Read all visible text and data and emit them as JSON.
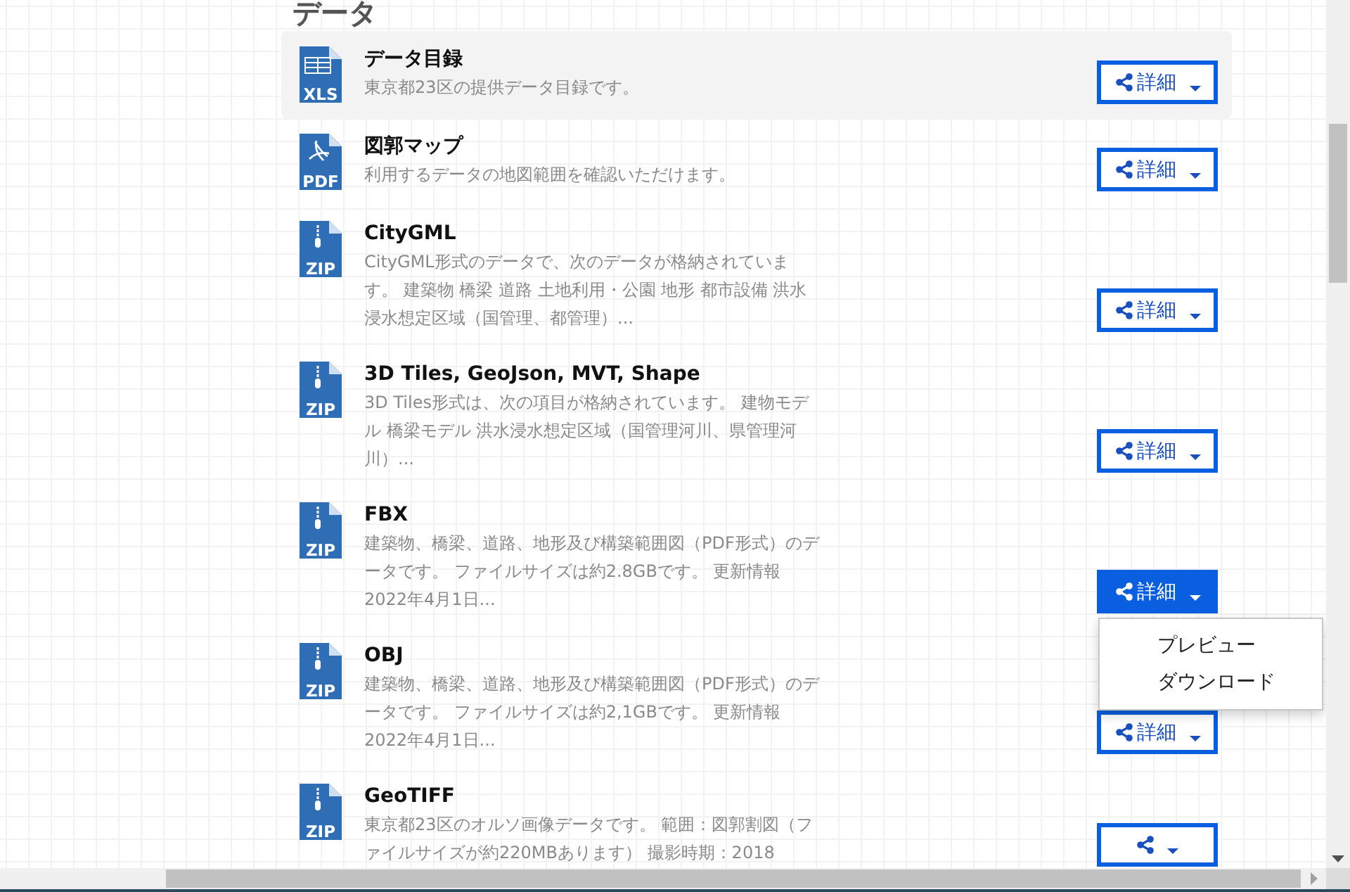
{
  "section": {
    "heading": "データ"
  },
  "items": [
    {
      "title": "データ目録",
      "description": "東京都23区の提供データ目録です。",
      "file_type": "XLS",
      "kind": "spreadsheet",
      "highlighted": true,
      "button": {
        "label": "詳細",
        "active": false
      }
    },
    {
      "title": "図郭マップ",
      "description": "利用するデータの地図範囲を確認いただけます。",
      "file_type": "PDF",
      "kind": "pdf",
      "highlighted": false,
      "button": {
        "label": "詳細",
        "active": false
      }
    },
    {
      "title": "CityGML",
      "description": "CityGML形式のデータで、次のデータが格納されています。 建築物 橋梁 道路 土地利用・公園 地形 都市設備 洪水浸水想定区域（国管理、都管理）...",
      "file_type": "ZIP",
      "kind": "archive",
      "highlighted": false,
      "button": {
        "label": "詳細",
        "active": false
      }
    },
    {
      "title": "3D Tiles, GeoJson, MVT, Shape",
      "description": "3D Tiles形式は、次の項目が格納されています。 建物モデル 橋梁モデル 洪水浸水想定区域（国管理河川、県管理河川）...",
      "file_type": "ZIP",
      "kind": "archive",
      "highlighted": false,
      "button": {
        "label": "詳細",
        "active": false
      }
    },
    {
      "title": "FBX",
      "description": "建築物、橋梁、道路、地形及び構築範囲図（PDF形式）のデータです。 ファイルサイズは約2.8GBです。 更新情報 2022年4月1日...",
      "file_type": "ZIP",
      "kind": "archive",
      "highlighted": false,
      "button": {
        "label": "詳細",
        "active": true
      },
      "menu": [
        "プレビュー",
        "ダウンロード"
      ]
    },
    {
      "title": "OBJ",
      "description": "建築物、橋梁、道路、地形及び構築範囲図（PDF形式）のデータです。 ファイルサイズは約2,1GBです。 更新情報 2022年4月1日...",
      "file_type": "ZIP",
      "kind": "archive",
      "highlighted": false,
      "button": {
        "label": "詳細",
        "active": false
      }
    },
    {
      "title": "GeoTIFF",
      "description": "東京都23区のオルソ画像データです。 範囲：図郭割図（ファイルサイズが約220MBあります） 撮影時期：2018",
      "file_type": "ZIP",
      "kind": "archive",
      "highlighted": false,
      "button": {
        "active": false
      }
    }
  ]
}
